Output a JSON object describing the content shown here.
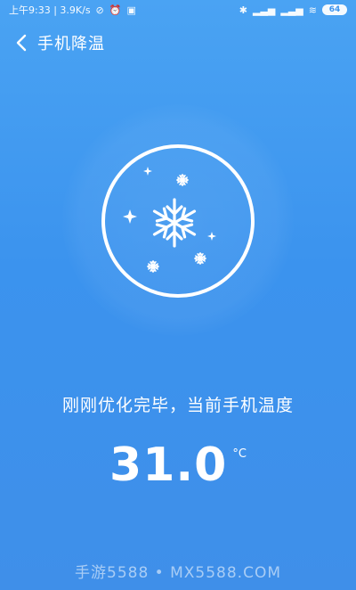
{
  "status_bar": {
    "left_text": "上午9:33 | 3.9K/s",
    "right_icons": [
      "bluetooth-icon",
      "signal-icon",
      "signal-icon",
      "wifi-icon"
    ],
    "battery": "64"
  },
  "nav": {
    "title": "手机降温",
    "back_icon": "chevron-left-icon"
  },
  "illustration": {
    "icon": "snowflake-icon",
    "accent_color": "#ffffff"
  },
  "message": "刚刚优化完毕，当前手机温度",
  "temperature": {
    "value": "31.0",
    "unit": "°C"
  },
  "watermark": "手游5588 • MX5588.COM",
  "colors": {
    "background_top": "#4aa3f3",
    "background_bottom": "#3f8fe9"
  }
}
